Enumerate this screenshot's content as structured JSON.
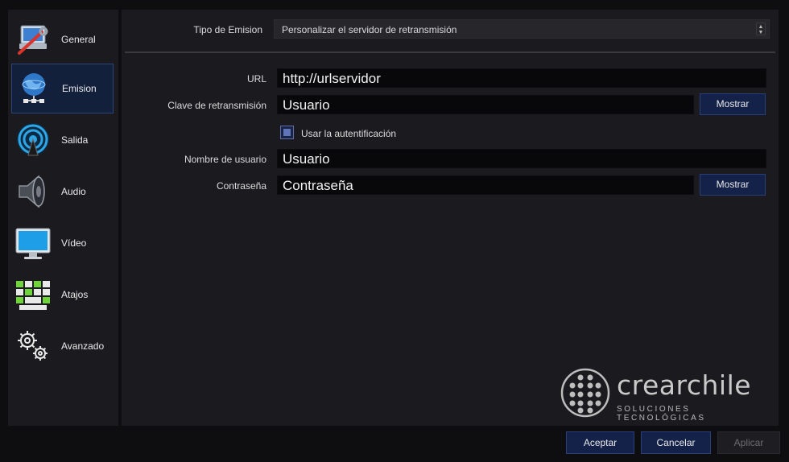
{
  "sidebar": {
    "items": [
      {
        "label": "General",
        "icon": "general-settings-icon"
      },
      {
        "label": "Emision",
        "icon": "globe-network-icon"
      },
      {
        "label": "Salida",
        "icon": "broadcast-antenna-icon"
      },
      {
        "label": "Audio",
        "icon": "speaker-icon"
      },
      {
        "label": "Vídeo",
        "icon": "monitor-icon"
      },
      {
        "label": "Atajos",
        "icon": "keyboard-icon"
      },
      {
        "label": "Avanzado",
        "icon": "gears-icon"
      }
    ],
    "active": "Emision"
  },
  "stream": {
    "type_label": "Tipo de Emision",
    "type_value": "Personalizar el servidor de retransmisión",
    "url_label": "URL",
    "url_value": "http://urlservidor",
    "key_label": "Clave de retransmisión",
    "key_value": "Usuario",
    "show_key_label": "Mostrar",
    "auth_checkbox_label": "Usar la autentificación",
    "auth_checked": true,
    "username_label": "Nombre de usuario",
    "username_value": "Usuario",
    "password_label": "Contraseña",
    "password_value": "Contraseña",
    "show_password_label": "Mostrar"
  },
  "logo": {
    "name": "crearchile",
    "tagline": "SOLUCIONES TECNOLÓGICAS"
  },
  "footer": {
    "accept_label": "Aceptar",
    "cancel_label": "Cancelar",
    "apply_label": "Aplicar"
  },
  "colors": {
    "accent": "#14224a",
    "panel": "#1b1b1f",
    "background": "#0e0e10"
  }
}
